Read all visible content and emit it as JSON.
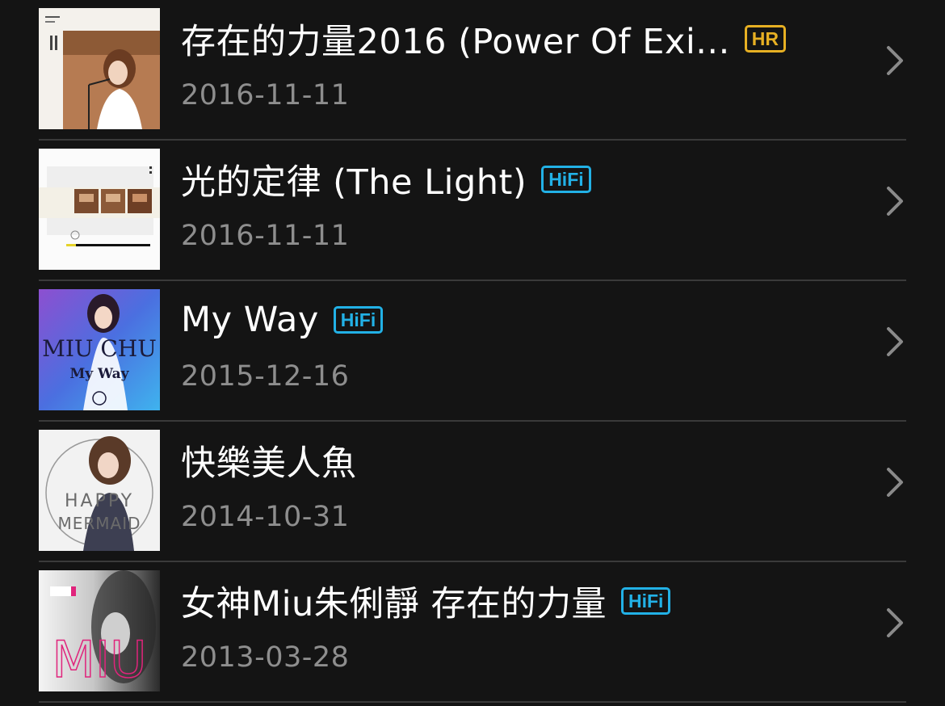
{
  "albums": [
    {
      "title": "存在的力量2016 (Power Of Exi...",
      "badge": "HR",
      "badge_type": "hr",
      "date": "2016-11-11"
    },
    {
      "title": "光的定律 (The Light)",
      "badge": "HiFi",
      "badge_type": "hifi",
      "date": "2016-11-11"
    },
    {
      "title": "My Way",
      "badge": "HiFi",
      "badge_type": "hifi",
      "date": "2015-12-16",
      "cover_text": [
        "MIU CHU",
        "My Way"
      ]
    },
    {
      "title": "快樂美人魚",
      "badge": "",
      "badge_type": "none",
      "date": "2014-10-31",
      "cover_text": [
        "HAPPY",
        "MERMAID"
      ]
    },
    {
      "title": "女神Miu朱俐靜 存在的力量",
      "badge": "HiFi",
      "badge_type": "hifi",
      "date": "2013-03-28",
      "cover_text": [
        "MIU"
      ]
    }
  ],
  "colors": {
    "background": "#141414",
    "title": "#ffffff",
    "date": "#8e8e8e",
    "hr_badge": "#e7b023",
    "hifi_badge": "#22b1e6",
    "chevron": "#8a8a8a",
    "divider": "#3a3a3a"
  },
  "icons": {
    "chevron": "chevron-right-icon"
  }
}
